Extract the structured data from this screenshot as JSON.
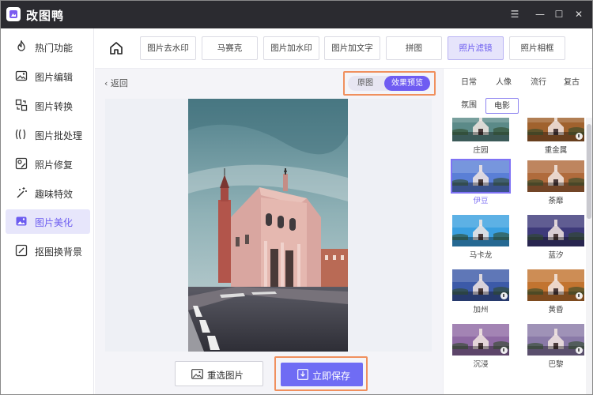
{
  "app": {
    "title": "改图鸭"
  },
  "window_controls": {
    "menu": "☰",
    "minimize": "—",
    "maximize": "☐",
    "close": "✕"
  },
  "sidebar": {
    "items": [
      {
        "label": "热门功能",
        "icon": "fire-icon"
      },
      {
        "label": "图片编辑",
        "icon": "image-edit-icon"
      },
      {
        "label": "图片转换",
        "icon": "convert-icon"
      },
      {
        "label": "图片批处理",
        "icon": "batch-icon"
      },
      {
        "label": "照片修复",
        "icon": "repair-icon"
      },
      {
        "label": "趣味特效",
        "icon": "magic-wand-icon"
      },
      {
        "label": "图片美化",
        "icon": "beautify-icon",
        "active": true
      },
      {
        "label": "抠图换背景",
        "icon": "cutout-icon"
      }
    ]
  },
  "topnav": {
    "tabs": [
      {
        "label": "图片去水印"
      },
      {
        "label": "马赛克"
      },
      {
        "label": "图片加水印"
      },
      {
        "label": "图片加文字"
      },
      {
        "label": "拼图"
      },
      {
        "label": "照片滤镜",
        "active": true
      },
      {
        "label": "照片相框"
      }
    ]
  },
  "main": {
    "back_label": "返回",
    "toggle": {
      "original": "原图",
      "preview": "效果预览"
    },
    "reselect_label": "重选图片",
    "save_label": "立即保存"
  },
  "filters": {
    "categories_row1": [
      "日常",
      "人像",
      "流行",
      "复古"
    ],
    "categories_row2": [
      "氛围",
      "电影"
    ],
    "active_category": "电影",
    "items": [
      {
        "label": "庄园",
        "tone": "#5b8a88"
      },
      {
        "label": "重金属",
        "tone": "#a0622e",
        "download": true
      },
      {
        "label": "伊豆",
        "tone": "#5a7fd6",
        "selected": true
      },
      {
        "label": "荼靡",
        "tone": "#b06b3c"
      },
      {
        "label": "马卡龙",
        "tone": "#3aa0e0"
      },
      {
        "label": "蓝汐",
        "tone": "#3e3a7a"
      },
      {
        "label": "加州",
        "tone": "#3c5aa8",
        "download": true
      },
      {
        "label": "黄昏",
        "tone": "#c27430",
        "download": true
      },
      {
        "label": "沉浸",
        "tone": "#8f6aa4",
        "download": true
      },
      {
        "label": "巴黎",
        "tone": "#8a7aa8",
        "download": true
      }
    ]
  },
  "colors": {
    "accent": "#6f5cf2",
    "highlight": "#f0905e"
  }
}
